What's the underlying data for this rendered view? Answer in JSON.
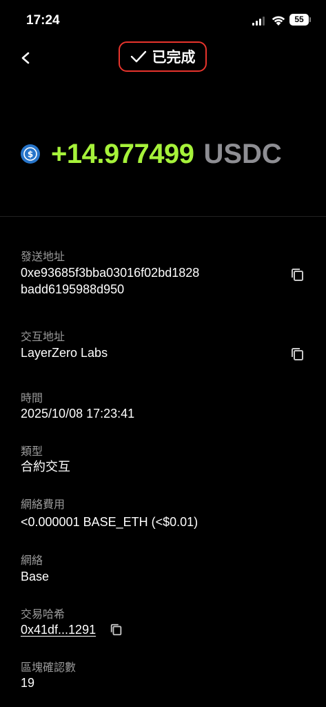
{
  "status_bar": {
    "time": "17:24",
    "battery": "55"
  },
  "header": {
    "status": "已完成"
  },
  "transaction": {
    "amount": "+14.977499",
    "currency": "USDC"
  },
  "details": {
    "sender": {
      "label": "發送地址",
      "line1": "0xe93685f3bba03016f02bd1828",
      "line2": "badd6195988d950"
    },
    "interact": {
      "label": "交互地址",
      "value": "LayerZero Labs"
    },
    "time": {
      "label": "時間",
      "value": "2025/10/08 17:23:41"
    },
    "type": {
      "label": "類型",
      "value": "合約交互"
    },
    "fee": {
      "label": "網絡費用",
      "value": "<0.000001 BASE_ETH (<$0.01)"
    },
    "network": {
      "label": "網絡",
      "value": "Base"
    },
    "hash": {
      "label": "交易哈希",
      "value": "0x41df...1291"
    },
    "confirmations": {
      "label": "區塊確認數",
      "value": "19"
    }
  },
  "colors": {
    "positive": "#a6f23a",
    "highlight": "#e8342c",
    "usdc": "#2775ca"
  }
}
